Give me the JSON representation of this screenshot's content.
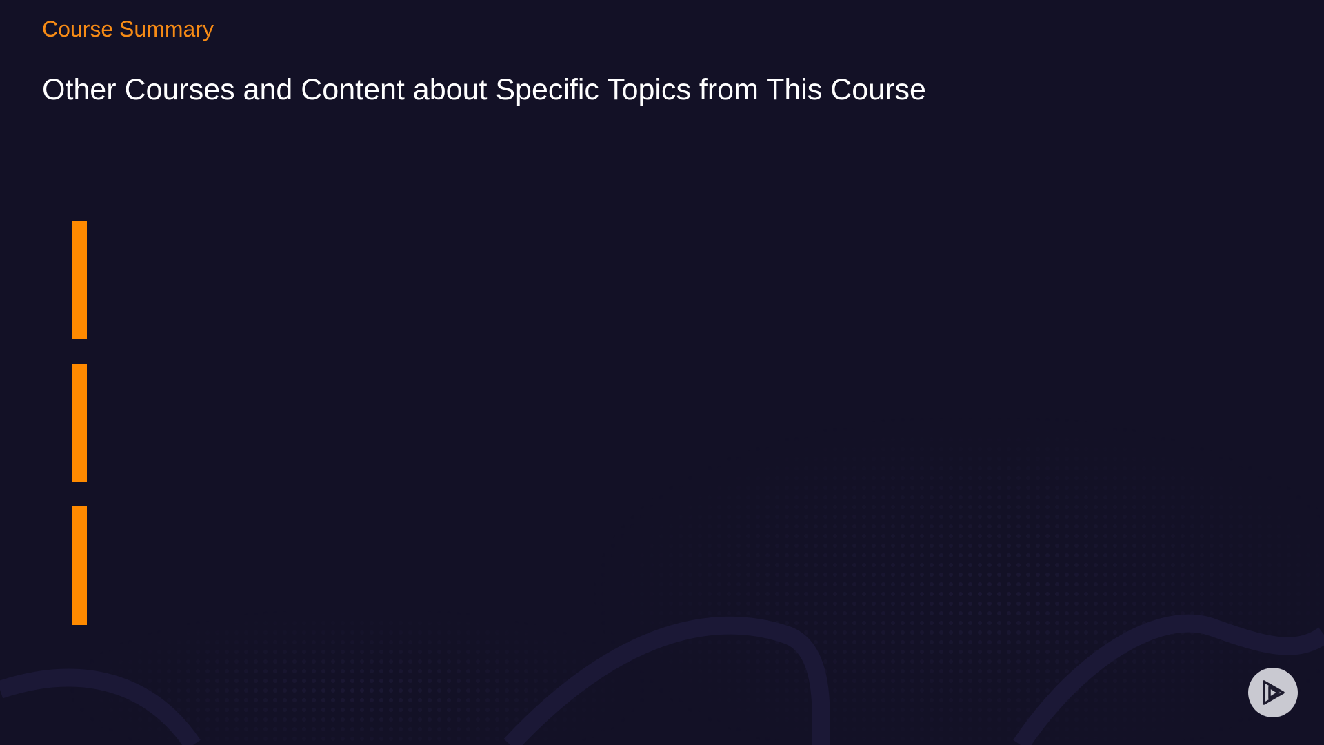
{
  "slide": {
    "section_label": "Course Summary",
    "title": "Other Courses and Content about Specific Topics from This Course"
  },
  "bullets": [
    {
      "text": ""
    },
    {
      "text": ""
    },
    {
      "text": ""
    }
  ],
  "logo": {
    "icon": "play-logo-icon"
  },
  "colors": {
    "background": "#131126",
    "accent": "#ff8a00",
    "label": "#f78b15",
    "title": "#ffffff",
    "logo_bg": "#c9c9d1",
    "logo_fg": "#1d1b2e"
  }
}
